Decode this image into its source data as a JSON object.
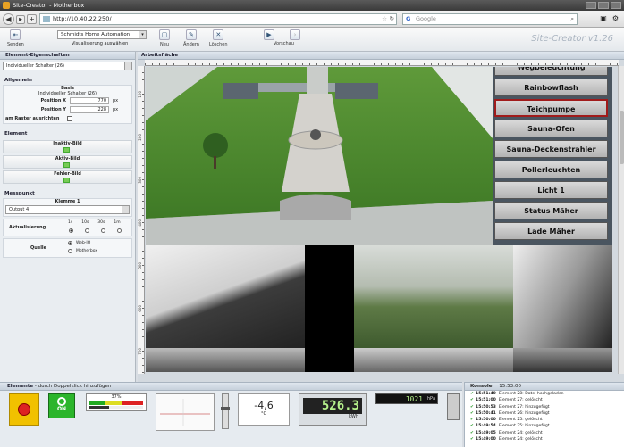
{
  "window": {
    "title": "Site-Creator - Motherbox"
  },
  "browser": {
    "url": "http://10.40.22.250/",
    "search_placeholder": "Google"
  },
  "toolbar": {
    "send_label": "Senden",
    "visualization_select": "Schmidts Home Automation",
    "visualization_label": "Visualisierung auswählen",
    "new_label": "Neu",
    "edit_label": "Ändern",
    "delete_label": "Löschen",
    "preview_label": "Vorschau",
    "brand": "Site-Creator v1.26"
  },
  "left": {
    "header": "Element-Eigenschaften",
    "element_select": "Individueller Schalter (26)",
    "general_title": "Allgemein",
    "basis_label": "Basis",
    "basis_value": "Individueller Schalter (26)",
    "posx_label": "Position X",
    "posx_value": "770",
    "posy_label": "Position Y",
    "posy_value": "228",
    "unit": "px",
    "snap_label": "am Raster ausrichten",
    "element_title": "Element",
    "inactive_img": "Inaktiv-Bild",
    "active_img": "Aktiv-Bild",
    "error_img": "Fehler-Bild",
    "measure_title": "Messpunkt",
    "terminal_label": "Klemme 1",
    "output_select": "Output 4",
    "update_label": "Aktualisierung",
    "update_options": [
      "1s",
      "10s",
      "30s",
      "1m"
    ],
    "source_label": "Quelle",
    "source_options": [
      "Web-IO",
      "Motherbox"
    ]
  },
  "work": {
    "header": "Arbeitsfläche",
    "ruler_numbers": [
      "100",
      "200",
      "300",
      "400",
      "500",
      "600",
      "700"
    ],
    "buttons": [
      "Wegbeleuchtung",
      "Rainbowflash",
      "Teichpumpe",
      "Sauna-Ofen",
      "Sauna-Deckenstrahler",
      "Pollerleuchten",
      "Licht 1",
      "Status Mäher",
      "Lade Mäher"
    ],
    "active_button": "Teichpumpe"
  },
  "elements": {
    "header": "Elemente",
    "hint": "- durch Doppelklick hinzufügen",
    "switch_label": "ON",
    "percent": "37%",
    "percent_value": 0.37,
    "temp_value": "-4,6",
    "temp_unit": "°C",
    "energy_value": "526.3",
    "energy_unit": "kWh",
    "pressure_value": "1021",
    "pressure_unit": "hPa"
  },
  "console": {
    "header": "Konsole",
    "time": "15:53:00",
    "rows": [
      {
        "time": "15:51:40",
        "text": "Element 28: Datei hochgeladen"
      },
      {
        "time": "15:51:00",
        "text": "Element 27: gelöscht"
      },
      {
        "time": "15:50:53",
        "text": "Element 27: hinzugefügt"
      },
      {
        "time": "15:50:41",
        "text": "Element 26: hinzugefügt"
      },
      {
        "time": "15:50:00",
        "text": "Element 25: gelöscht"
      },
      {
        "time": "15:49:54",
        "text": "Element 25: hinzugefügt"
      },
      {
        "time": "15:49:05",
        "text": "Element 24: gelöscht"
      },
      {
        "time": "15:49:00",
        "text": "Element 24: gelöscht"
      }
    ]
  },
  "colors": {
    "accent": "#357aa8",
    "active_border": "#a01b1b",
    "switch_green": "#2bb52b",
    "lcd_green": "#b6f28c"
  }
}
